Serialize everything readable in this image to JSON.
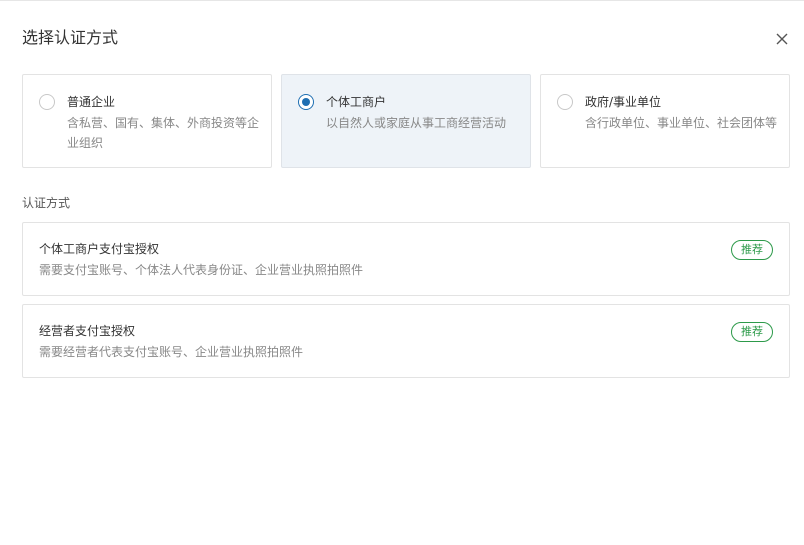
{
  "dialog": {
    "title": "选择认证方式",
    "close_icon": "close-icon"
  },
  "types": [
    {
      "title": "普通企业",
      "desc": "含私营、国有、集体、外商投资等企业组织",
      "selected": false
    },
    {
      "title": "个体工商户",
      "desc": "以自然人或家庭从事工商经营活动",
      "selected": true
    },
    {
      "title": "政府/事业单位",
      "desc": "含行政单位、事业单位、社会团体等",
      "selected": false
    }
  ],
  "section_label": "认证方式",
  "methods": [
    {
      "title": "个体工商户支付宝授权",
      "desc": "需要支付宝账号、个体法人代表身份证、企业营业执照拍照件",
      "badge": "推荐"
    },
    {
      "title": "经营者支付宝授权",
      "desc": "需要经营者代表支付宝账号、企业营业执照拍照件",
      "badge": "推荐"
    }
  ],
  "colors": {
    "selected_accent": "#1f6fb2",
    "selected_bg": "#eef3f8",
    "badge_green": "#2d9a4a"
  }
}
